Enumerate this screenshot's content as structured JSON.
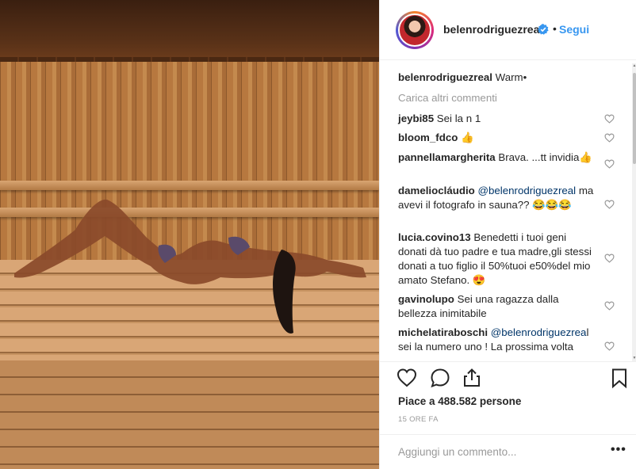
{
  "post": {
    "username": "belenrodriguezreal",
    "follow_label": "Segui",
    "separator": "•",
    "caption_user": "belenrodriguezreal",
    "caption_text": " Warm•",
    "load_more": "Carica altri commenti",
    "likes": "Piace a 488.582 persone",
    "timestamp": "15 ORE FA",
    "add_comment_placeholder": "Aggiungi un commento...",
    "more_options": "•••"
  },
  "comments": [
    {
      "user": "jeybi85",
      "text": " Sei la n 1"
    },
    {
      "user": "bloom_fdco",
      "text": " 👍"
    },
    {
      "user": "pannellamargherita",
      "text": " Brava. ...tt invidia👍"
    },
    {
      "user": "dameliocláudio",
      "mention": " @belenrodriguezreal",
      "text": " ma avevi il fotografo in sauna?? 😂😂😂"
    },
    {
      "user": "lucia.covino13",
      "text": " Benedetti i tuoi geni donati dà tuo padre e tua madre,gli stessi donati a tuo figlio il 50%tuoi e50%del mio amato Stefano. 😍"
    },
    {
      "user": "gavinolupo",
      "text": " Sei una ragazza dalla bellezza inimitabile"
    },
    {
      "user": "michelatiraboschi",
      "mention": " @belenrodriguezrea",
      "text": "l sei la numero uno ! La prossima volta"
    }
  ],
  "icons": {
    "heart": "heart-icon",
    "comment": "comment-icon",
    "share": "share-icon",
    "bookmark": "bookmark-icon",
    "verified": "verified-icon"
  },
  "colors": {
    "link": "#3897f0",
    "mention": "#003569",
    "muted": "#999999",
    "verified": "#3897f0"
  }
}
